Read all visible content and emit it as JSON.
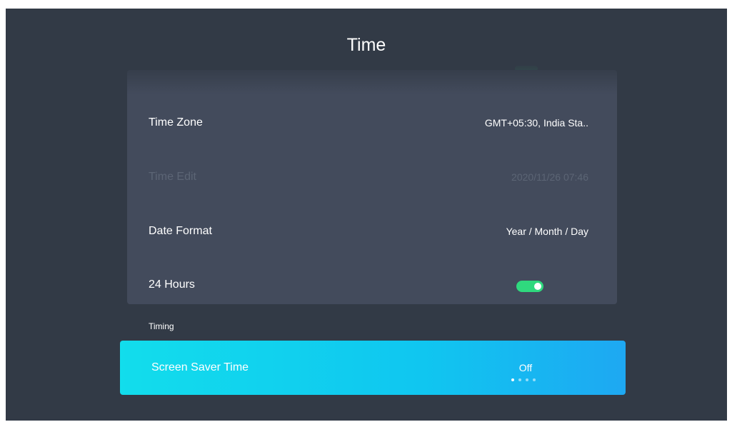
{
  "header": {
    "title": "Time"
  },
  "settings": {
    "rows": [
      {
        "label": "Time Zone",
        "value": "GMT+05:30, India Sta.."
      },
      {
        "label": "Time Edit",
        "value": "2020/11/26 07:46"
      },
      {
        "label": "Date Format",
        "value": "Year / Month / Day"
      },
      {
        "label": "24 Hours",
        "value": ""
      }
    ],
    "toggle_24h": true
  },
  "timing_section": {
    "header": "Timing",
    "screen_saver": {
      "label": "Screen Saver Time",
      "value": "Off",
      "option_count": 4,
      "selected_index": 0
    }
  },
  "colors": {
    "background": "#323a46",
    "panel": "#434b5c",
    "toggle_on": "#2fd97e",
    "focus_start": "#12ddec",
    "focus_end": "#1ea8f2"
  }
}
